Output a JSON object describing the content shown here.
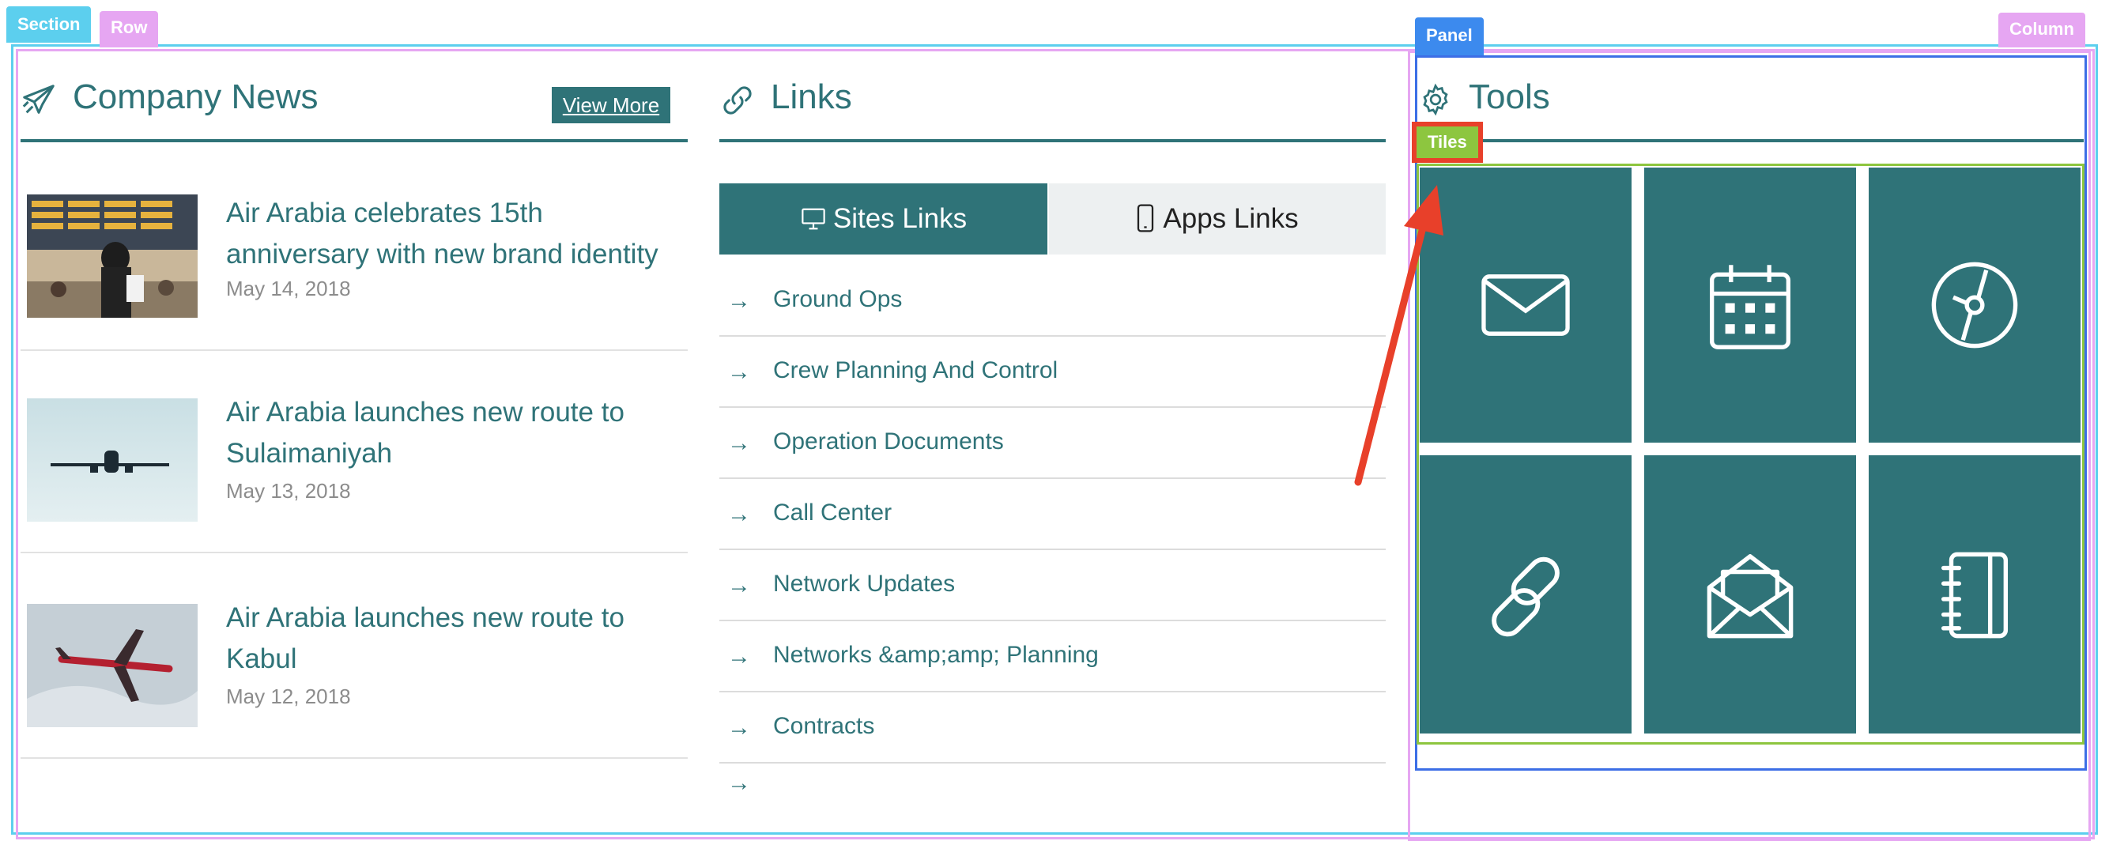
{
  "overlay": {
    "section_tag": "Section",
    "row_tag": "Row",
    "panel_tag": "Panel",
    "column_tag": "Column",
    "tiles_tag": "Tiles",
    "annotation_color": "#e8402a"
  },
  "news": {
    "title": "Company News",
    "icon": "airplane-icon",
    "view_more": "View More",
    "items": [
      {
        "title": "Air Arabia celebrates 15th anniversary with new brand identity",
        "date": "May 14, 2018",
        "image": "airport-departures-board-photo"
      },
      {
        "title": "Air Arabia launches new route to Sulaimaniyah",
        "date": "May 13, 2018",
        "image": "plane-in-sky-photo"
      },
      {
        "title": "Air Arabia launches new route to Kabul",
        "date": "May 12, 2018",
        "image": "red-plane-above-clouds-photo"
      }
    ]
  },
  "links": {
    "title": "Links",
    "icon": "link-icon",
    "tabs": [
      {
        "label": "Sites Links",
        "icon": "monitor-icon",
        "active": true
      },
      {
        "label": "Apps Links",
        "icon": "phone-icon",
        "active": false
      }
    ],
    "items": [
      "Ground Ops",
      "Crew Planning And Control",
      "Operation Documents",
      "Call Center",
      "Network Updates",
      "Networks &amp;amp; Planning",
      "Contracts"
    ]
  },
  "tools": {
    "title": "Tools",
    "icon": "gear-icon",
    "tiles": [
      "mail-icon",
      "calendar-icon",
      "disc-icon",
      "chain-link-icon",
      "open-mail-icon",
      "notebook-icon"
    ]
  },
  "colors": {
    "accent": "#2f7378",
    "tab_inactive": "#edf0f1"
  }
}
